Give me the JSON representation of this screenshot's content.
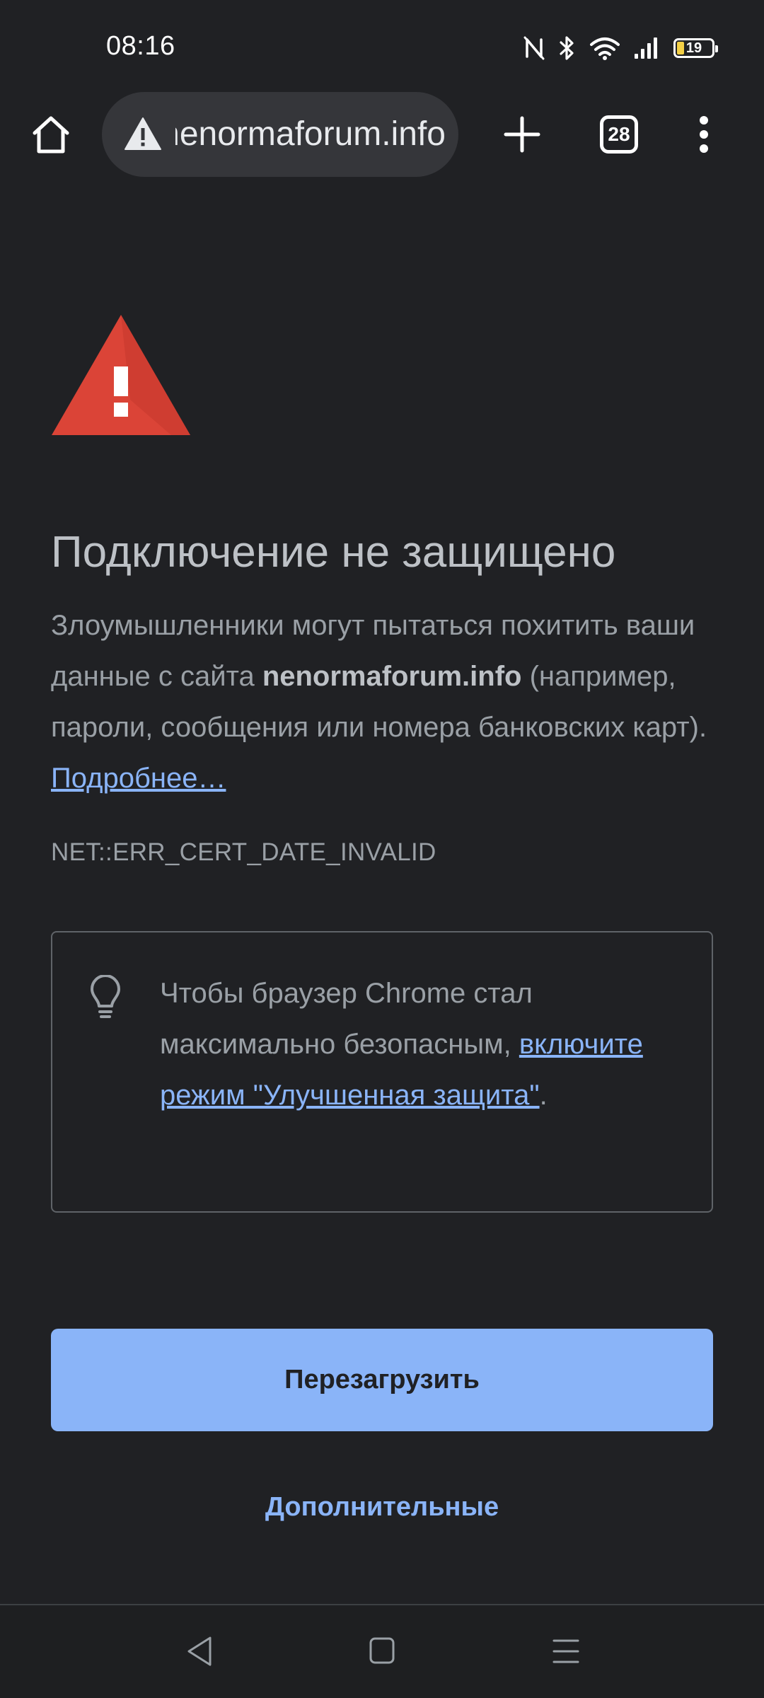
{
  "status_bar": {
    "time": "08:16",
    "battery_level": "19",
    "icons": [
      "nfc-icon",
      "bluetooth-icon",
      "wifi-icon",
      "signal-icon",
      "battery-icon"
    ]
  },
  "toolbar": {
    "url": "nenormaforum.info",
    "tab_count": "28",
    "icons": [
      "home-icon",
      "not-secure-warning-icon",
      "plus-icon",
      "tab-switcher-icon",
      "more-vert-icon"
    ]
  },
  "interstitial": {
    "heading": "Подключение не защищено",
    "body_before": "Злоумышленники могут пытаться похитить ваши данные с сайта ",
    "body_domain": "nenormaforum.info",
    "body_after": " (например, пароли, сообщения или номера банковских карт). ",
    "learn_more_link": "Подробнее…",
    "error_code": "NET::ERR_CERT_DATE_INVALID",
    "tip_before": "Чтобы браузер Chrome стал максимально безопасным, ",
    "tip_link": "включите режим \"Улучшенная защита\"",
    "tip_after": ".",
    "reload_button": "Перезагрузить",
    "advanced_button": "Дополнительные"
  },
  "colors": {
    "background": "#202124",
    "accent": "#8ab4f8",
    "warning_red": "#db4437"
  },
  "nav_bar": {
    "icons": [
      "back-icon",
      "home-square-icon",
      "recents-menu-icon"
    ]
  }
}
